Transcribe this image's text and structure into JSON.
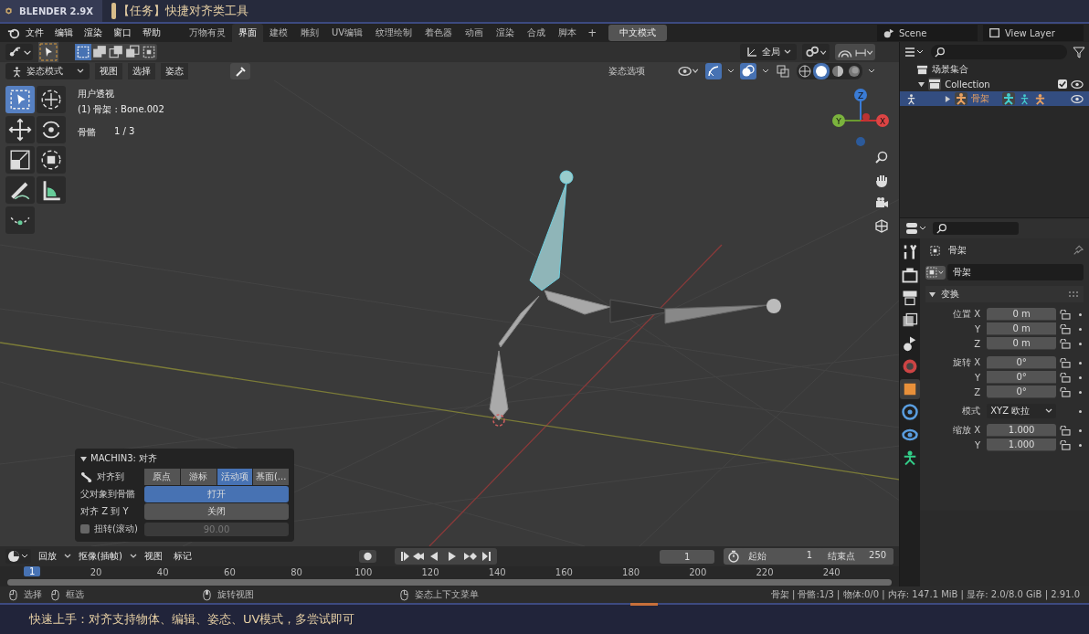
{
  "video_header": {
    "badge": "BLENDER 2.9X",
    "title": "【任务】快捷对齐类工具"
  },
  "menu_bar": [
    "文件",
    "编辑",
    "渲染",
    "窗口",
    "帮助"
  ],
  "workspace_tabs": [
    {
      "label": "万物有灵",
      "selected": false
    },
    {
      "label": "界面",
      "selected": true
    },
    {
      "label": "建模",
      "selected": false
    },
    {
      "label": "雕刻",
      "selected": false
    },
    {
      "label": "UV编辑",
      "selected": false
    },
    {
      "label": "纹理绘制",
      "selected": false
    },
    {
      "label": "着色器",
      "selected": false
    },
    {
      "label": "动画",
      "selected": false
    },
    {
      "label": "渲染",
      "selected": false
    },
    {
      "label": "合成",
      "selected": false
    },
    {
      "label": "脚本",
      "selected": false
    }
  ],
  "add_tab": "+",
  "language_button": "中文模式",
  "scene": "Scene",
  "view_layer": "View Layer",
  "tool_header": {
    "select_modes": [
      {
        "kind": "new",
        "selected": true
      },
      {
        "kind": "extend",
        "selected": false
      },
      {
        "kind": "subtract",
        "selected": false
      },
      {
        "kind": "invert",
        "selected": false
      },
      {
        "kind": "intersect",
        "selected": false
      }
    ],
    "orientation": "全局",
    "proportional_on": true
  },
  "mode_header": {
    "mode": "姿态模式",
    "menus": [
      "视图",
      "选择",
      "姿态"
    ],
    "options": "姿态选项",
    "gizmos_on": true,
    "overlays_on": true,
    "xray_on": false,
    "shading": [
      {
        "kind": "wireframe",
        "selected": false
      },
      {
        "kind": "solid",
        "selected": true
      },
      {
        "kind": "material",
        "selected": false
      },
      {
        "kind": "rendered",
        "selected": false
      }
    ]
  },
  "tools": [
    {
      "kind": "select",
      "selected": true
    },
    {
      "kind": "cursor",
      "selected": false
    },
    {
      "kind": "move",
      "selected": false
    },
    {
      "kind": "rotate",
      "selected": false
    },
    {
      "kind": "scale",
      "selected": false
    },
    {
      "kind": "transform",
      "selected": false
    },
    {
      "kind": "annotate",
      "selected": false
    },
    {
      "kind": "measure",
      "selected": false
    },
    {
      "kind": "relax",
      "selected": false
    }
  ],
  "viewport": {
    "view_name": "用户透视",
    "active": "(1) 骨架 : Bone.002",
    "stat_label": "骨骼",
    "stat_value": "1 / 3",
    "axes": [
      "Z",
      "Y",
      "X"
    ]
  },
  "operator_panel": {
    "title": "MACHIN3: 对齐",
    "expanded": true,
    "rows": [
      {
        "kind": "choice",
        "label": "对齐到",
        "options": [
          {
            "label": "原点",
            "selected": false
          },
          {
            "label": "游标",
            "selected": false
          },
          {
            "label": "活动项",
            "selected": true
          },
          {
            "label": "基面(...",
            "selected": false
          }
        ]
      },
      {
        "kind": "toggle",
        "label": "父对象到骨骼",
        "value": "打开",
        "on": true
      },
      {
        "kind": "toggle",
        "label": "对齐 Z 到 Y",
        "value": "关闭",
        "on": false
      },
      {
        "kind": "number",
        "label": "扭转(滚动)",
        "value": "90.00",
        "checked": false
      }
    ]
  },
  "timeline": {
    "menus": [
      "回放",
      "抠像(插帧)",
      "视图",
      "标记"
    ],
    "current_frame": "1",
    "start_label": "起始",
    "start": "1",
    "end_label": "结束点",
    "end": "250",
    "marker": "1",
    "ruler": [
      "20",
      "40",
      "60",
      "80",
      "100",
      "120",
      "140",
      "160",
      "180",
      "200",
      "220",
      "240"
    ]
  },
  "status_bar": {
    "hints": [
      "选择",
      "框选",
      "旋转视图",
      "姿态上下文菜单"
    ],
    "stats": "骨架 | 骨骼:1/3 | 物体:0/0 | 内存: 147.1 MiB | 显存: 2.0/8.0 GiB | 2.91.0"
  },
  "outliner": {
    "items": [
      {
        "label": "场景集合",
        "children": [
          {
            "label": "Collection",
            "expanded": true,
            "checked": true,
            "children": [
              {
                "label": "骨架",
                "expanded": false,
                "selected": true
              }
            ]
          }
        ]
      }
    ]
  },
  "properties": {
    "tabs": [
      {
        "kind": "tool",
        "selected": false
      },
      {
        "kind": "render",
        "selected": false
      },
      {
        "kind": "output",
        "selected": false
      },
      {
        "kind": "view-layer",
        "selected": false
      },
      {
        "kind": "scene",
        "selected": false
      },
      {
        "kind": "world",
        "selected": false
      },
      {
        "kind": "object",
        "selected": true
      },
      {
        "kind": "physics",
        "selected": false
      },
      {
        "kind": "constraint",
        "selected": false
      },
      {
        "kind": "data",
        "selected": false
      }
    ],
    "object_name": "骨架",
    "data_name": "骨架",
    "section": "变换",
    "expanded": true,
    "groups": [
      {
        "kind": "vector",
        "label": "位置",
        "rows": [
          {
            "axis": "X",
            "value": "0 m"
          },
          {
            "axis": "Y",
            "value": "0 m"
          },
          {
            "axis": "Z",
            "value": "0 m"
          }
        ]
      },
      {
        "kind": "vector",
        "label": "旋转",
        "rows": [
          {
            "axis": "X",
            "value": "0°"
          },
          {
            "axis": "Y",
            "value": "0°"
          },
          {
            "axis": "Z",
            "value": "0°"
          }
        ]
      },
      {
        "kind": "dropdown",
        "label": "模式",
        "value": "XYZ 欧拉"
      },
      {
        "kind": "vector",
        "label": "缩放",
        "rows": [
          {
            "axis": "X",
            "value": "1.000"
          },
          {
            "axis": "Y",
            "value": "1.000"
          }
        ]
      }
    ]
  },
  "subtitle": "快速上手：对齐支持物体、编辑、姿态、UV模式，多尝试即可"
}
